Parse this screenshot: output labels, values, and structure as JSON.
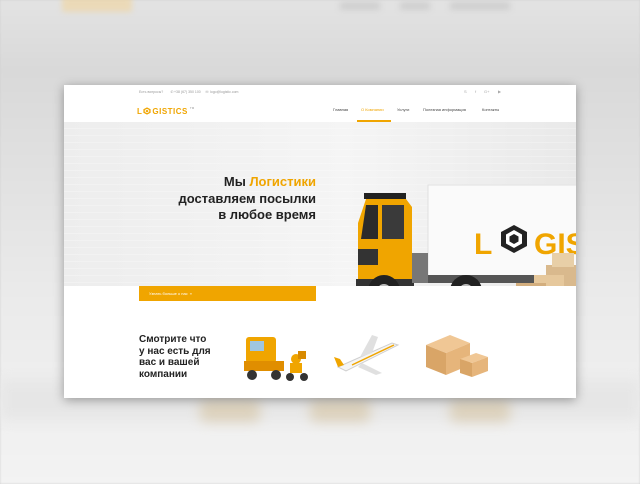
{
  "topbar": {
    "question": "Есть вопросы?",
    "phone": "+38 (67) 350 100",
    "email": "logo@logistic.com",
    "social": [
      "skype-icon",
      "facebook-icon",
      "google-plus-icon",
      "youtube-icon"
    ]
  },
  "brand": {
    "logo_start": "L",
    "logo_end": "GISTICS",
    "tm": "TM"
  },
  "nav": {
    "items": [
      "Главная",
      "О Компании",
      "Услуги",
      "Полезная информация",
      "Контакты"
    ],
    "active_index": 1
  },
  "hero": {
    "line1_prefix": "Мы ",
    "line1_accent": "Логистики",
    "line2": "доставляем посылки",
    "line3": "в любое время",
    "cta_label": "Узнать больше о нас",
    "cta_arrow": "»",
    "truck_text_start": "L",
    "truck_text_end": "GIS"
  },
  "section": {
    "title_lines": [
      "Смотрите что",
      "у нас есть для",
      "вас и вашей",
      "компании"
    ]
  },
  "colors": {
    "accent": "#f0a500",
    "text": "#222222",
    "hero_bg": "#efefef"
  }
}
